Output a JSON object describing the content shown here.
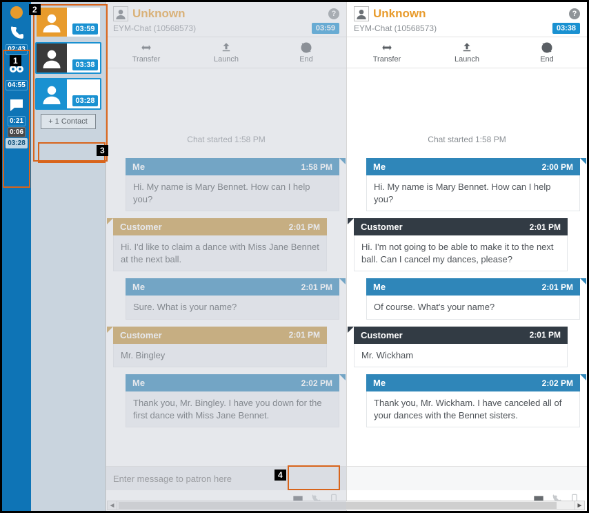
{
  "rail": {
    "slots": [
      {
        "icon": "phone-icon",
        "time": "02:43"
      },
      {
        "icon": "voicemail-icon",
        "time": "04:55"
      },
      {
        "icon": "chat-icon",
        "time": "0:21",
        "extra": [
          "0:06",
          "03:28"
        ]
      }
    ]
  },
  "channels": {
    "items": [
      {
        "color": "amber",
        "time": "03:59",
        "selected": false
      },
      {
        "color": "dark",
        "time": "03:38",
        "selected": true
      },
      {
        "color": "blue",
        "time": "03:28",
        "selected": true
      }
    ],
    "plus_contact_label": "+ 1 Contact"
  },
  "panes": [
    {
      "dim": true,
      "name": "Unknown",
      "sub": "EYM-Chat (10568573)",
      "timer": "03:59",
      "started": "Chat started 1:58 PM",
      "actions": {
        "transfer": "Transfer",
        "launch": "Launch",
        "end": "End"
      },
      "messages": [
        {
          "who": "Me",
          "when": "1:58 PM",
          "body": "Hi. My name is Mary Bennet. How can I help you?",
          "kind": "me"
        },
        {
          "who": "Customer",
          "when": "2:01 PM",
          "body": "Hi. I'd like to claim a dance with Miss Jane Bennet at the next ball.",
          "kind": "cust"
        },
        {
          "who": "Me",
          "when": "2:01 PM",
          "body": "Sure. What is your name?",
          "kind": "me"
        },
        {
          "who": "Customer",
          "when": "2:01 PM",
          "body": "Mr. Bingley",
          "kind": "cust"
        },
        {
          "who": "Me",
          "when": "2:02 PM",
          "body": "Thank you, Mr. Bingley. I have you down for the first dance with Miss Jane Bennet.",
          "kind": "me"
        }
      ],
      "compose_placeholder": "Enter message to patron here"
    },
    {
      "dim": false,
      "name": "Unknown",
      "sub": "EYM-Chat (10568573)",
      "timer": "03:38",
      "started": "Chat started 1:58 PM",
      "actions": {
        "transfer": "Transfer",
        "launch": "Launch",
        "end": "End"
      },
      "messages": [
        {
          "who": "Me",
          "when": "2:00 PM",
          "body": "Hi. My name is Mary Bennet. How can I help you?",
          "kind": "me"
        },
        {
          "who": "Customer",
          "when": "2:01 PM",
          "body": "Hi. I'm not going to be able to make it to the next ball. Can I cancel my dances, please?",
          "kind": "cust-dark"
        },
        {
          "who": "Me",
          "when": "2:01 PM",
          "body": "Of course. What's your name?",
          "kind": "me"
        },
        {
          "who": "Customer",
          "when": "2:01 PM",
          "body": "Mr. Wickham",
          "kind": "cust-dark"
        },
        {
          "who": "Me",
          "when": "2:02 PM",
          "body": "Thank you, Mr. Wickham. I have canceled all of your dances with the Bennet sisters.",
          "kind": "me"
        }
      ],
      "compose_placeholder": ""
    }
  ],
  "annotations": {
    "1": "1",
    "2": "2",
    "3": "3",
    "4": "4"
  }
}
